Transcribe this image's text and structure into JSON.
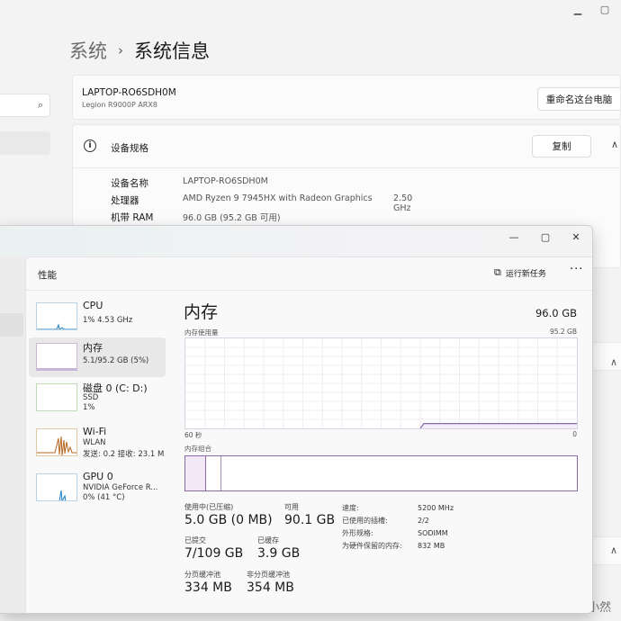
{
  "settings": {
    "breadcrumb_parent": "系统",
    "breadcrumb_sep": "›",
    "breadcrumb_current": "系统信息",
    "pc_name": "LAPTOP-RO6SDH0M",
    "pc_model": "Legion R9000P ARX8",
    "rename_button": "重命名这台电脑",
    "spec_title": "设备规格",
    "copy_button": "复制",
    "specs": [
      {
        "key": "设备名称",
        "value": "LAPTOP-RO6SDH0M",
        "extra": ""
      },
      {
        "key": "处理器",
        "value": "AMD Ryzen 9 7945HX with Radeon Graphics",
        "extra": "2.50 GHz"
      },
      {
        "key": "机带 RAM",
        "value": "96.0 GB (95.2 GB 可用)",
        "extra": ""
      }
    ]
  },
  "task_manager": {
    "header_title": "性能",
    "run_task": "运行新任务",
    "more": "···",
    "items": [
      {
        "name": "CPU",
        "sub1": "1% 4.53 GHz",
        "sub2": ""
      },
      {
        "name": "内存",
        "sub1": "5.1/95.2 GB (5%)",
        "sub2": ""
      },
      {
        "name": "磁盘 0 (C: D:)",
        "sub1": "SSD",
        "sub2": "1%"
      },
      {
        "name": "Wi-Fi",
        "sub1": "WLAN",
        "sub2": "发送: 0.2 接收: 23.1 M"
      },
      {
        "name": "GPU 0",
        "sub1": "NVIDIA GeForce R...",
        "sub2": "0% (41 °C)"
      }
    ],
    "memory": {
      "title": "内存",
      "total": "96.0 GB",
      "usage_label": "内存使用量",
      "max_label": "95.2 GB",
      "axis_left": "60 秒",
      "axis_right": "0",
      "composition_label": "内存组合",
      "usage_fraction": 0.054,
      "composition_used_fraction": 0.054,
      "composition_modified_fraction": 0.093,
      "stats": {
        "in_use_label": "使用中(已压缩)",
        "in_use_value": "5.0 GB (0 MB)",
        "available_label": "可用",
        "available_value": "90.1 GB",
        "committed_label": "已提交",
        "committed_value": "7/109 GB",
        "cached_label": "已缓存",
        "cached_value": "3.9 GB",
        "paged_label": "分页缓冲池",
        "paged_value": "334 MB",
        "nonpaged_label": "非分页缓冲池",
        "nonpaged_value": "354 MB"
      },
      "properties": [
        {
          "key": "速度:",
          "value": "5200 MHz"
        },
        {
          "key": "已使用的插槽:",
          "value": "2/2"
        },
        {
          "key": "外形规格:",
          "value": "SODIMM"
        },
        {
          "key": "为硬件保留的内存:",
          "value": "832 MB"
        }
      ]
    }
  },
  "watermark": "微博 @机小然",
  "colors": {
    "memory_accent": "#8c6aa6",
    "cpu_accent": "#1a7fc4",
    "disk_accent": "#4da744",
    "wifi_accent": "#b3641c"
  }
}
